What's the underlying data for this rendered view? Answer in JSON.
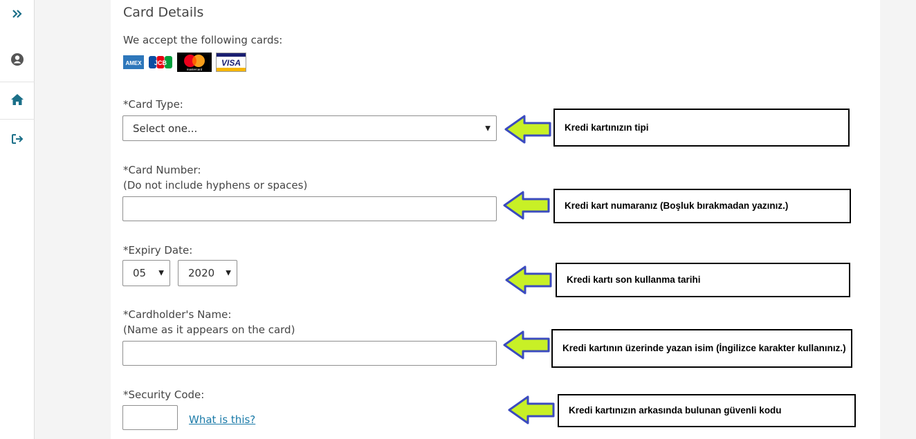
{
  "page": {
    "title": "Card Details"
  },
  "cards": {
    "accept_text": "We accept the following cards:",
    "items": [
      {
        "name": "amex",
        "label": "AMEX"
      },
      {
        "name": "jcb",
        "label": "JCB"
      },
      {
        "name": "mastercard",
        "label": "mastercard"
      },
      {
        "name": "visa",
        "label": "VISA"
      }
    ]
  },
  "form": {
    "card_type": {
      "label": "*Card Type:",
      "selected": "Select one..."
    },
    "card_number": {
      "label": "*Card Number:",
      "hint": "(Do not include hyphens or spaces)",
      "value": ""
    },
    "expiry": {
      "label": "*Expiry Date:",
      "month": "05",
      "year": "2020"
    },
    "holder": {
      "label": "*Cardholder's Name:",
      "hint": "(Name as it appears on the card)",
      "value": ""
    },
    "security": {
      "label": "*Security Code:",
      "value": "",
      "help_link": "What is this?"
    }
  },
  "annotations": {
    "card_type": "Kredi kartınızın tipi",
    "card_number": "Kredi kart numaranız (Boşluk bırakmadan yazınız.)",
    "expiry": "Kredi kartı son kullanma tarihi",
    "holder": "Kredi kartının üzerinde yazan isim (İngilizce karakter kullanınız.)",
    "security": "Kredi kartınızın arkasında bulunan güvenli kodu"
  },
  "colors": {
    "sidebar_icon": "#1b6f88",
    "link": "#1a7aa8",
    "arrow_fill": "#c8f026",
    "arrow_stroke": "#3b4bbf"
  },
  "icons": [
    "expand-icon",
    "user-icon",
    "home-icon",
    "logout-icon"
  ]
}
